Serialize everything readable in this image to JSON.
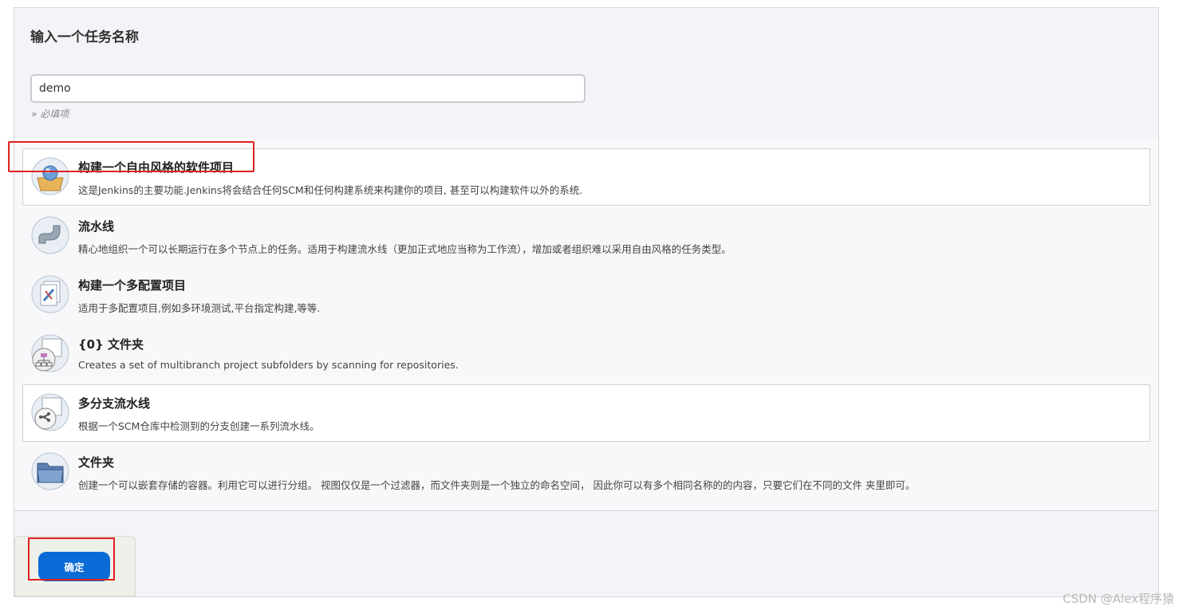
{
  "form": {
    "title": "输入一个任务名称",
    "name_value": "demo",
    "required_hint": "» 必填项"
  },
  "item_types": [
    {
      "icon": "freestyle-project-icon",
      "label": "构建一个自由风格的软件项目",
      "desc": "这是Jenkins的主要功能.Jenkins将会结合任何SCM和任何构建系统来构建你的项目, 甚至可以构建软件以外的系统.",
      "selected": true
    },
    {
      "icon": "pipeline-icon",
      "label": "流水线",
      "desc": "精心地组织一个可以长期运行在多个节点上的任务。适用于构建流水线（更加正式地应当称为工作流），增加或者组织难以采用自由风格的任务类型。"
    },
    {
      "icon": "multi-config-project-icon",
      "label": "构建一个多配置项目",
      "desc": "适用于多配置项目,例如多环境测试,平台指定构建,等等."
    },
    {
      "icon": "organization-folder-icon",
      "label": "{0} 文件夹",
      "desc": "Creates a set of multibranch project subfolders by scanning for repositories."
    },
    {
      "icon": "multibranch-pipeline-icon",
      "label": "多分支流水线",
      "desc": "根据一个SCM仓库中检测到的分支创建一系列流水线。",
      "hovered": true
    },
    {
      "icon": "folder-icon",
      "label": "文件夹",
      "desc": "创建一个可以嵌套存储的容器。利用它可以进行分组。 视图仅仅是一个过滤器，而文件夹则是一个独立的命名空间， 因此你可以有多个相同名称的的内容，只要它们在不同的文件 夹里即可。"
    }
  ],
  "actions": {
    "ok_label": "确定"
  },
  "watermark": "CSDN @Alex程序猿",
  "colors": {
    "accent": "#0b6bd6",
    "highlight": "#e02020"
  }
}
